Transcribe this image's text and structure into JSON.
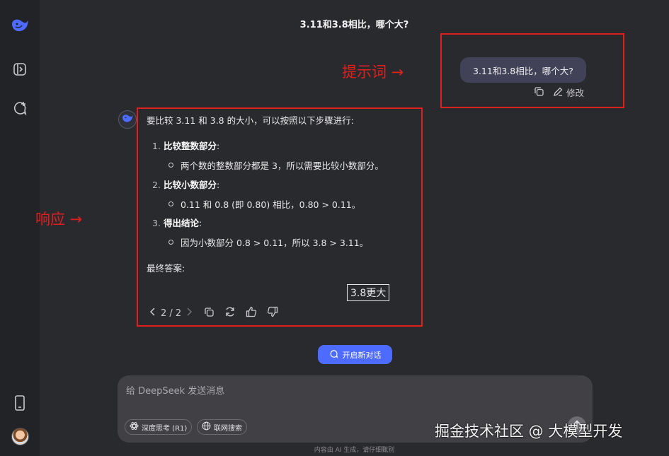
{
  "chat_title": "3.11和3.8相比，哪个大?",
  "user_message": {
    "text": "3.11和3.8相比，哪个大?",
    "edit_label": "修改"
  },
  "annotations": {
    "prompt_label": "提示词 →",
    "response_label": "响应 →",
    "box_color": "#e01f1f"
  },
  "response": {
    "intro": "要比较 3.11 和 3.8 的大小，可以按照以下步骤进行:",
    "steps": [
      {
        "num": "1.",
        "heading": "比较整数部分",
        "colon": ":",
        "bullet": "两个数的整数部分都是 3，所以需要比较小数部分。"
      },
      {
        "num": "2.",
        "heading": "比较小数部分",
        "colon": ":",
        "bullet": "0.11 和 0.8 (即 0.80) 相比，0.80 > 0.11。"
      },
      {
        "num": "3.",
        "heading": "得出结论",
        "colon": ":",
        "bullet": "因为小数部分 0.8 > 0.11，所以 3.8 > 3.11。"
      }
    ],
    "final_label": "最终答案:",
    "final_answer": "3.8更大",
    "pager": "2 / 2"
  },
  "new_chat_label": "开启新对话",
  "composer": {
    "placeholder": "给 DeepSeek 发送消息",
    "deep_think_label": "深度思考 (R1)",
    "web_search_label": "联网搜索"
  },
  "footer_note": "内容由 AI 生成，请仔细甄别",
  "watermark": "掘金技术社区 @ 大模型开发",
  "colors": {
    "accent": "#4d6bfe",
    "background": "#292a2d",
    "sidebar": "#212327"
  },
  "icons": [
    "deepseek-logo-icon",
    "sidebar-toggle-icon",
    "new-chat-icon",
    "phone-icon",
    "copy-icon",
    "edit-icon",
    "chevron-left-icon",
    "chevron-right-icon",
    "regenerate-icon",
    "thumbs-up-icon",
    "thumbs-down-icon",
    "deep-think-icon",
    "globe-icon",
    "send-icon"
  ]
}
